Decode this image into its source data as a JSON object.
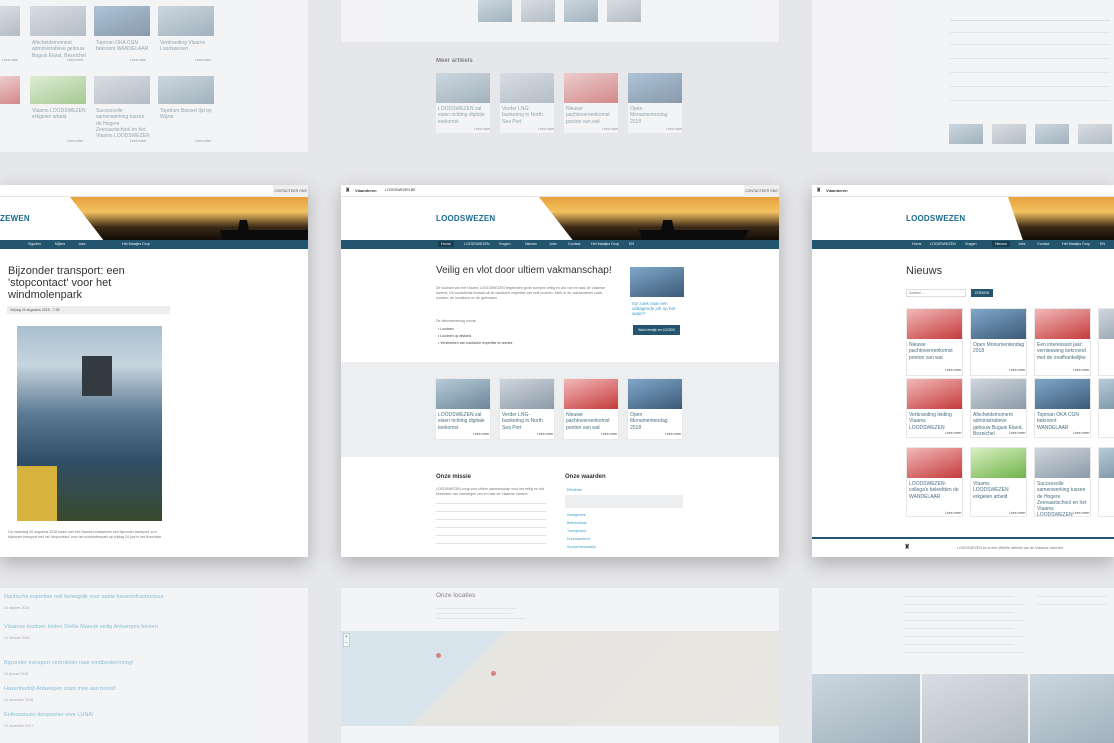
{
  "top_left_card": {
    "items": [
      {
        "text": "Afscheidsmoment administratieve gebouw Buguis Eland, Bezeichel"
      },
      {
        "text": "Topman OKA CGN bekroont WANDELAAR"
      },
      {
        "text": "Verbranding Vlaams Loodswezen"
      },
      {
        "text": "Vlaams LOODSWEZEN erkgelen arbeid"
      },
      {
        "text": "Succesvolle samenwerking tussen de Hogere Zeevaartschool en het Vlaams LOODSWEZEN"
      },
      {
        "text": "Topdrum Baswel tijd op Wijzer"
      }
    ],
    "more": "Lees meer"
  },
  "top_center_card": {
    "heading": "Meer artikels",
    "items": [
      {
        "text": "LOODSWEZEN zal eisen richting digitale toekomst"
      },
      {
        "text": "Verder LNG-bunkering in North Sea Port"
      },
      {
        "text": "Nieuwe pachtovereenkomst ponton van wal"
      },
      {
        "text": "Open Monumentendag 2018"
      }
    ],
    "more": "Lees meer"
  },
  "left_card": {
    "logo": "ZEWEN",
    "contact": "CONTACTEER ONS",
    "nav": [
      "Vlgoden",
      "Mijkes",
      "Jobs",
      "Het Maatjes Dorp"
    ],
    "title": "Bijzonder transport: een 'stopcontact' voor het windmolenpark",
    "date": "Vrijdag 24 augustus 2018 - 7:28",
    "caption": "Op maandag 20 augustus 2018 kwam met het Vlaams loodswezen een bijzonder transport, zo'n bijzonder transport met het 'stopcontact' voor het windmolenpark op vrijdag 24 juni in het Noordzee."
  },
  "center_card": {
    "brand": "Vlaanderen",
    "brand_sub": "LOODSWEZEN.BE",
    "logo": "LOODSWEZEN",
    "contact": "CONTACTEER ONS",
    "nav": [
      "Home",
      "LOODSWEZEN",
      "Vragen",
      "Nieuws",
      "Jobs",
      "Contact",
      "Het Maatjes Dorp",
      "EN"
    ],
    "title": "Veilig en vlot door ultiem vakmanschap!",
    "intro": "De loodsen van het Vlaams LOODSWEZEN begeleiden grote schepen veilig en vlot van en naar de Vlaamse havens. De loodsdienst bestaat uit de nautische expertise van vele loodsen. Meer in de vakdomeinen zoals loodsen, de loodsboot en de gebouwen.",
    "list_label": "De dienstverlening omvat:",
    "bullets": [
      "Loodsen",
      "Loodsen op afstand",
      "Verstrekken van nautische expertise en advies"
    ],
    "promo_text": "Op zoek naar een uitdagende job op het water?",
    "promo_button": "Word eindje en LOODS",
    "news": [
      {
        "text": "LOODSWEZEN zal eisen richting digitale toekomst"
      },
      {
        "text": "Verder LNG-bunkering in North Sea Port"
      },
      {
        "text": "Nieuwe pachtovereenkomst ponton van wal"
      },
      {
        "text": "Open Monumentendag 2018"
      }
    ],
    "more": "Lees meer",
    "mission_title": "Onze missie",
    "mission_text": "LOODSWEZEN zorgt voor ultiem vakmanschap voor het veilig en vlot betrekken van vaarwegen van en naar de Vlaamse havens.",
    "values_title": "Onze waarden",
    "values": [
      "Efficiëntie",
      "Klantgericht",
      "Betrouwbaar",
      "Transparant",
      "Duurzaamheid",
      "Sociaal bewustzijn"
    ]
  },
  "right_card": {
    "brand": "Vlaanderen",
    "logo": "LOODSWEZEN",
    "nav": [
      "Home",
      "LOODSWEZEN",
      "Vragen",
      "Nieuws",
      "Jobs",
      "Contact",
      "Het Maatjes Dorp",
      "EN"
    ],
    "title": "Nieuws",
    "search_placeholder": "Zoeken ...",
    "search_button": "ZOEKEN",
    "news": [
      {
        "text": "Nieuwe pachtovereenkomst ponton van wal"
      },
      {
        "text": "Open Monumentendag 2018"
      },
      {
        "text": "Een interessant jaar: vernieuwing bekroond met de onafhankelijke"
      },
      {
        "text": "Verbranding leiding Vlaams LOODSWEZEN"
      },
      {
        "text": "Afscheidsmoment administratieve gebouw Buguis Eland, Bezeichel"
      },
      {
        "text": "Topman OKA CGN bekroont WANDELAAR"
      },
      {
        "text": "LOODSWEZEN-collega's beleefden de WANDELAAR"
      },
      {
        "text": "Vlaams LOODSWEZEN erkgelen arbeid"
      },
      {
        "text": "Succesvolle samenwerking tussen de Hogere Zeevaartschool en het Vlaams LOODSWEZEN"
      }
    ],
    "more": "Lees meer",
    "footer": "LOODSWEZEN.be is een officiële website van de Vlaamse overheid"
  },
  "bottom_left_card": {
    "links": [
      {
        "text": "Nautische expertise ook belangrijk voor aaste haveninfrastructuur",
        "date": "20 oktober 2018"
      },
      {
        "text": "Vlaamse loodsen leiden Stellis Maersk veilig Antwerpen binnen",
        "date": "14 februari 2018"
      },
      {
        "text": "Bijzonder transport vertrokken naar eindbestemming!",
        "date": "24 januari 2018"
      },
      {
        "text": "Havenbedrijf Antwerpen stapt mee aan boord!",
        "date": "14 december 2018"
      },
      {
        "text": "Enthousiaste doopmeter voor LUNA!",
        "date": "10 december 2017"
      }
    ]
  },
  "bottom_center_card": {
    "heading": "Onze locaties"
  }
}
